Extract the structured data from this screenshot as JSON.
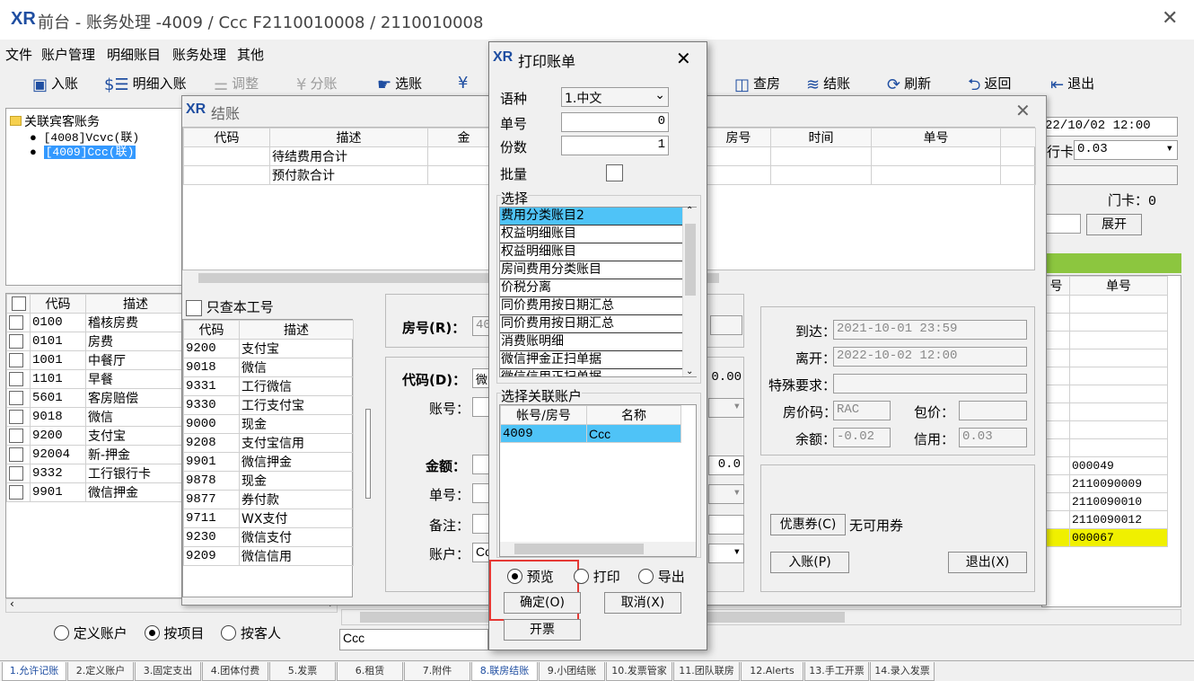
{
  "title": {
    "logo": "XR",
    "text": "前台 - 账务处理 -4009 / Ccc F2110010008 / 2110010008"
  },
  "menu": [
    "文件",
    "账户管理",
    "明细账目",
    "账务处理",
    "其他"
  ],
  "toolbar": {
    "post": "入账",
    "detail_post": "明细入账",
    "adjust": "调整",
    "split": "分账",
    "select_account": "选账",
    "check_room": "查房",
    "checkout": "结账",
    "refresh": "刷新",
    "back": "返回",
    "exit": "退出"
  },
  "tree": {
    "root": "关联宾客账务",
    "items": [
      "[4008]Vcvc(联)",
      "[4009]Ccc(联)"
    ]
  },
  "left_table": {
    "headers": [
      "代码",
      "描述"
    ],
    "rows": [
      [
        "0100",
        "稽核房费"
      ],
      [
        "0101",
        "房费"
      ],
      [
        "1001",
        "中餐厅"
      ],
      [
        "1101",
        "早餐"
      ],
      [
        "5601",
        "客房赔偿"
      ],
      [
        "9018",
        "微信"
      ],
      [
        "9200",
        "支付宝"
      ],
      [
        "92004",
        "新-押金"
      ],
      [
        "9332",
        "工行银行卡"
      ],
      [
        "9901",
        "微信押金"
      ]
    ]
  },
  "radio_filter": {
    "define_account": "定义账户",
    "by_item": "按项目",
    "by_guest": "按客人"
  },
  "status_text": "Ccc",
  "right_info": {
    "time": "22/10/02 12:00",
    "card_label": "行卡",
    "card_value": "0.03",
    "door_card": "门卡：0",
    "expand": "展开"
  },
  "right_table": {
    "headers": [
      "号",
      "单号"
    ],
    "rows": [
      "000049",
      "2110090009",
      "2110090010",
      "2110090012",
      "000067"
    ]
  },
  "checkout": {
    "title": "结账",
    "headers": [
      "代码",
      "描述",
      "金",
      "房号",
      "时间",
      "单号"
    ],
    "rows": [
      [
        "",
        "待结费用合计"
      ],
      [
        "",
        "预付款合计"
      ]
    ],
    "only_check": "只查本工号",
    "pay_headers": [
      "代码",
      "描述"
    ],
    "pay_rows": [
      [
        "9200",
        "支付宝"
      ],
      [
        "9018",
        "微信"
      ],
      [
        "9331",
        "工行微信"
      ],
      [
        "9330",
        "工行支付宝"
      ],
      [
        "9000",
        "现金"
      ],
      [
        "9208",
        "支付宝信用"
      ],
      [
        "9901",
        "微信押金"
      ],
      [
        "9878",
        "现金"
      ],
      [
        "9877",
        "券付款"
      ],
      [
        "9711",
        "WX支付"
      ],
      [
        "9230",
        "微信支付"
      ],
      [
        "9209",
        "微信信用"
      ]
    ],
    "room_label": "房号(R)：",
    "room_val": "40",
    "code_label": "代码(D)：",
    "code_val": "微",
    "account_label": "账号：",
    "amount_label": "金额：",
    "bill_label": "单号：",
    "remark_label": "备注：",
    "acct_label": "账户：",
    "acct_val": "Cc",
    "amt1": "0.00",
    "amt2": "0.0",
    "arrive_label": "到达：",
    "arrive": "2021-10-01 23:59",
    "leave_label": "离开：",
    "leave": "2022-10-02 12:00",
    "special_label": "特殊要求：",
    "rate_label": "房价码：",
    "rate": "RAC",
    "package_label": "包价：",
    "balance_label": "余额：",
    "balance": "-0.02",
    "credit_label": "信用：",
    "credit": "0.03",
    "coupon_btn": "优惠券(C)",
    "coupon_text": "无可用券",
    "post_btn": "入账(P)",
    "exit_btn": "退出(X)"
  },
  "print": {
    "title": "打印账单",
    "lang_label": "语种",
    "lang": "1.中文",
    "no_label": "单号",
    "no": "0",
    "copies_label": "份数",
    "copies": "1",
    "batch_label": "批量",
    "choose_label": "选择",
    "options": [
      "费用分类账目2",
      "权益明细账目",
      "权益明细账目",
      "房间费用分类账目",
      "价税分离",
      "同价费用按日期汇总",
      "同价费用按日期汇总",
      "消费账明细",
      "微信押金正扫单据",
      "微信信用正扫单据"
    ],
    "link_label": "选择关联账户",
    "link_headers": [
      "帐号/房号",
      "名称"
    ],
    "link_rows": [
      [
        "4009",
        "Ccc"
      ]
    ],
    "preview": "预览",
    "print": "打印",
    "export": "导出",
    "ok": "确定(O)",
    "cancel": "取消(X)",
    "invoice": "开票"
  },
  "tabs": [
    "1.允许记账",
    "2.定义账户",
    "3.固定支出",
    "4.团体付费",
    "5.发票",
    "6.租赁",
    "7.附件",
    "8.联房结账",
    "9.小团结账",
    "10.发票管家",
    "11.团队联房",
    "12.Alerts",
    "13.手工开票",
    "14.录入发票"
  ],
  "colors": {
    "accent": "#1f4ea1",
    "selection": "#4fc3f7",
    "highlight": "#f0f000",
    "green_bar": "#8cc63f",
    "red_box": "#e53935"
  }
}
